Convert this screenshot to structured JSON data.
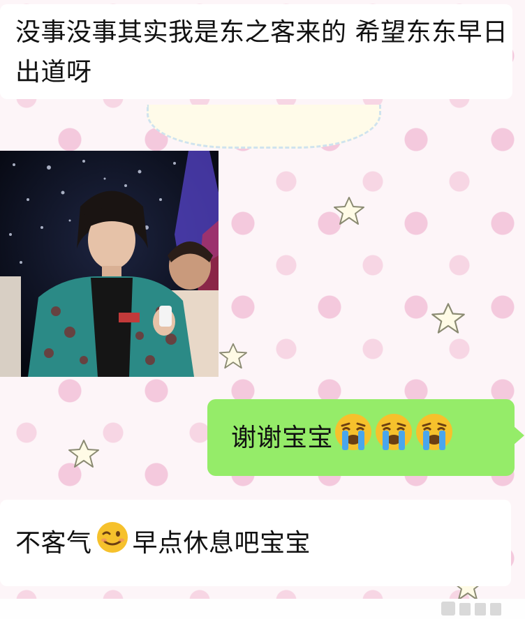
{
  "chat": {
    "messages": [
      {
        "side": "incoming",
        "text": "没事没事其实我是东之客来的 希望东东早日出道呀"
      },
      {
        "side": "incoming",
        "type": "image",
        "alt": ""
      },
      {
        "side": "outgoing",
        "text": "谢谢宝宝",
        "emoji": [
          "loudly-crying-face",
          "loudly-crying-face",
          "loudly-crying-face"
        ]
      },
      {
        "side": "incoming",
        "text_before": "不客气",
        "emoji": "winking-face",
        "text_after": "早点休息吧宝宝"
      }
    ]
  },
  "colors": {
    "outgoing_bubble": "#95ec69",
    "incoming_bubble": "#ffffff",
    "background": "#fdf5f8",
    "dots": "#f4c9dd"
  }
}
